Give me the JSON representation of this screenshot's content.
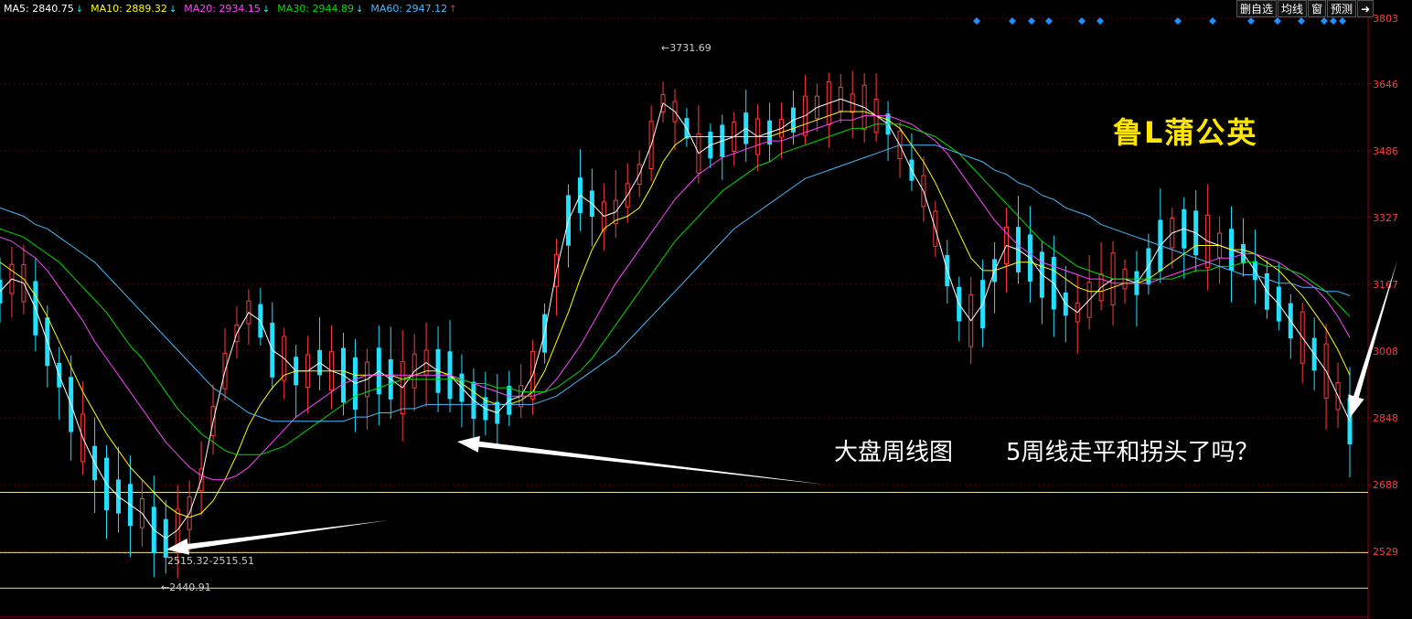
{
  "header": {
    "ma_items": [
      {
        "label": "MA5:",
        "value": "2840.75",
        "arrow": "↓",
        "color": "#ffffff",
        "arrow_color": "#00ffff"
      },
      {
        "label": "MA10:",
        "value": "2889.32",
        "arrow": "↓",
        "color": "#ffff00",
        "arrow_color": "#00ffff"
      },
      {
        "label": "MA20:",
        "value": "2934.15",
        "arrow": "↓",
        "color": "#ff44ff",
        "arrow_color": "#00ffff"
      },
      {
        "label": "MA30:",
        "value": "2944.89",
        "arrow": "↓",
        "color": "#00dd00",
        "arrow_color": "#00ffff"
      },
      {
        "label": "MA60:",
        "value": "2947.12",
        "arrow": "↑",
        "color": "#44bbff",
        "arrow_color": "#ff3333"
      }
    ]
  },
  "toolbar": {
    "buttons": [
      "删自选",
      "均线",
      "窗",
      "预测"
    ],
    "exit_icon": "exit-arrow-icon"
  },
  "watermark": "鲁L蒲公英",
  "annotations": {
    "title": "大盘周线图",
    "question": "5周线走平和拐头了吗？"
  },
  "colors": {
    "up": "#ff3b3b",
    "down": "#22e0ff",
    "grid": "#6a0000",
    "axis": "#9a0000",
    "tick_text": "#ff3b3b",
    "support_line": "#e6e68a",
    "marker": "#1e90ff"
  },
  "chart_data": {
    "type": "candlestick",
    "period": "weekly",
    "y_ticks": [
      3803,
      3646,
      3486,
      3327,
      3167,
      3008,
      2848,
      2688,
      2529
    ],
    "ylim": [
      2370,
      3803
    ],
    "grid": true,
    "horizontal_lines": [
      2670,
      2526,
      2440.91
    ],
    "labels": {
      "high": "3731.69",
      "low": "2440.91",
      "range": "2515.32-2515.51"
    },
    "markers_count": 14,
    "series": [
      {
        "name": "MA5",
        "color": "#ffffff",
        "width": 1,
        "values": [
          3150,
          3180,
          3170,
          3110,
          3030,
          2950,
          2880,
          2800,
          2740,
          2690,
          2660,
          2640,
          2620,
          2580,
          2560,
          2580,
          2620,
          2700,
          2840,
          2960,
          3050,
          3100,
          3080,
          3010,
          2990,
          2960,
          2960,
          2980,
          2960,
          2950,
          2930,
          2940,
          2960,
          2940,
          2920,
          2960,
          2980,
          2960,
          2950,
          2920,
          2890,
          2870,
          2860,
          2890,
          2900,
          2950,
          3050,
          3200,
          3320,
          3380,
          3360,
          3330,
          3340,
          3380,
          3430,
          3500,
          3600,
          3580,
          3540,
          3480,
          3500,
          3510,
          3520,
          3540,
          3520,
          3530,
          3540,
          3560,
          3570,
          3590,
          3600,
          3610,
          3600,
          3590,
          3570,
          3550,
          3500,
          3440,
          3390,
          3300,
          3200,
          3120,
          3080,
          3120,
          3200,
          3260,
          3250,
          3230,
          3190,
          3170,
          3120,
          3100,
          3130,
          3160,
          3180,
          3180,
          3170,
          3210,
          3260,
          3290,
          3300,
          3290,
          3270,
          3260,
          3250,
          3240,
          3200,
          3150,
          3120,
          3080,
          3040,
          3000,
          2960,
          2900,
          2840
        ]
      },
      {
        "name": "MA10",
        "color": "#ffff00",
        "width": 1,
        "values": [
          3220,
          3200,
          3180,
          3140,
          3090,
          3030,
          2970,
          2910,
          2860,
          2810,
          2770,
          2730,
          2700,
          2670,
          2640,
          2620,
          2610,
          2620,
          2650,
          2700,
          2760,
          2830,
          2880,
          2920,
          2950,
          2960,
          2960,
          2960,
          2960,
          2960,
          2950,
          2950,
          2950,
          2950,
          2940,
          2950,
          2960,
          2960,
          2950,
          2930,
          2910,
          2890,
          2880,
          2880,
          2890,
          2910,
          2960,
          3030,
          3100,
          3180,
          3250,
          3300,
          3320,
          3330,
          3350,
          3400,
          3460,
          3500,
          3520,
          3520,
          3520,
          3520,
          3520,
          3520,
          3520,
          3520,
          3530,
          3540,
          3550,
          3560,
          3570,
          3580,
          3580,
          3580,
          3570,
          3560,
          3540,
          3500,
          3460,
          3410,
          3350,
          3290,
          3230,
          3200,
          3200,
          3210,
          3220,
          3220,
          3210,
          3200,
          3180,
          3160,
          3150,
          3150,
          3160,
          3170,
          3170,
          3180,
          3200,
          3220,
          3240,
          3260,
          3260,
          3260,
          3250,
          3250,
          3240,
          3220,
          3200,
          3170,
          3140,
          3100,
          3060,
          3010,
          2950
        ]
      },
      {
        "name": "MA20",
        "color": "#ff44ff",
        "width": 1,
        "values": [
          3280,
          3270,
          3250,
          3230,
          3200,
          3160,
          3120,
          3080,
          3030,
          2990,
          2950,
          2910,
          2870,
          2830,
          2790,
          2760,
          2730,
          2710,
          2700,
          2700,
          2710,
          2730,
          2760,
          2790,
          2820,
          2850,
          2870,
          2890,
          2910,
          2930,
          2940,
          2950,
          2950,
          2950,
          2950,
          2950,
          2950,
          2950,
          2950,
          2940,
          2930,
          2920,
          2910,
          2900,
          2900,
          2900,
          2910,
          2940,
          2980,
          3020,
          3070,
          3120,
          3170,
          3210,
          3250,
          3290,
          3330,
          3370,
          3400,
          3430,
          3450,
          3470,
          3480,
          3490,
          3500,
          3510,
          3510,
          3520,
          3530,
          3540,
          3550,
          3560,
          3560,
          3570,
          3570,
          3570,
          3560,
          3550,
          3530,
          3510,
          3480,
          3440,
          3400,
          3360,
          3320,
          3290,
          3260,
          3240,
          3220,
          3210,
          3200,
          3190,
          3180,
          3180,
          3170,
          3170,
          3170,
          3170,
          3180,
          3190,
          3200,
          3210,
          3220,
          3230,
          3230,
          3240,
          3240,
          3230,
          3220,
          3200,
          3180,
          3160,
          3130,
          3090,
          3040
        ]
      },
      {
        "name": "MA30",
        "color": "#00dd00",
        "width": 1,
        "values": [
          3300,
          3290,
          3280,
          3260,
          3240,
          3220,
          3190,
          3160,
          3130,
          3100,
          3060,
          3020,
          2990,
          2950,
          2910,
          2870,
          2840,
          2810,
          2790,
          2770,
          2760,
          2760,
          2760,
          2770,
          2780,
          2800,
          2820,
          2840,
          2860,
          2880,
          2900,
          2910,
          2920,
          2930,
          2940,
          2940,
          2940,
          2940,
          2940,
          2940,
          2930,
          2930,
          2920,
          2920,
          2910,
          2910,
          2910,
          2920,
          2940,
          2960,
          2990,
          3030,
          3070,
          3110,
          3150,
          3190,
          3230,
          3270,
          3300,
          3330,
          3360,
          3390,
          3410,
          3430,
          3450,
          3460,
          3480,
          3490,
          3500,
          3510,
          3520,
          3530,
          3540,
          3540,
          3550,
          3550,
          3550,
          3540,
          3530,
          3520,
          3500,
          3480,
          3450,
          3420,
          3390,
          3360,
          3330,
          3300,
          3270,
          3250,
          3230,
          3210,
          3200,
          3190,
          3180,
          3180,
          3180,
          3180,
          3180,
          3180,
          3190,
          3200,
          3200,
          3210,
          3210,
          3220,
          3220,
          3210,
          3210,
          3200,
          3190,
          3170,
          3150,
          3120,
          3090
        ]
      },
      {
        "name": "MA60",
        "color": "#44bbff",
        "width": 1,
        "values": [
          3350,
          3340,
          3330,
          3310,
          3300,
          3280,
          3260,
          3240,
          3220,
          3190,
          3160,
          3130,
          3100,
          3070,
          3040,
          3010,
          2980,
          2950,
          2920,
          2900,
          2880,
          2860,
          2850,
          2840,
          2840,
          2840,
          2840,
          2840,
          2840,
          2840,
          2850,
          2850,
          2860,
          2860,
          2870,
          2870,
          2880,
          2880,
          2880,
          2880,
          2880,
          2880,
          2880,
          2880,
          2880,
          2880,
          2890,
          2900,
          2920,
          2940,
          2960,
          2980,
          3000,
          3030,
          3060,
          3090,
          3120,
          3150,
          3180,
          3210,
          3240,
          3270,
          3300,
          3320,
          3340,
          3360,
          3380,
          3400,
          3420,
          3430,
          3440,
          3450,
          3460,
          3470,
          3480,
          3490,
          3500,
          3500,
          3500,
          3500,
          3490,
          3480,
          3470,
          3460,
          3440,
          3430,
          3410,
          3400,
          3380,
          3370,
          3350,
          3340,
          3330,
          3310,
          3300,
          3290,
          3280,
          3270,
          3260,
          3250,
          3240,
          3230,
          3220,
          3210,
          3200,
          3190,
          3190,
          3180,
          3170,
          3170,
          3160,
          3160,
          3150,
          3150,
          3140
        ]
      }
    ]
  }
}
